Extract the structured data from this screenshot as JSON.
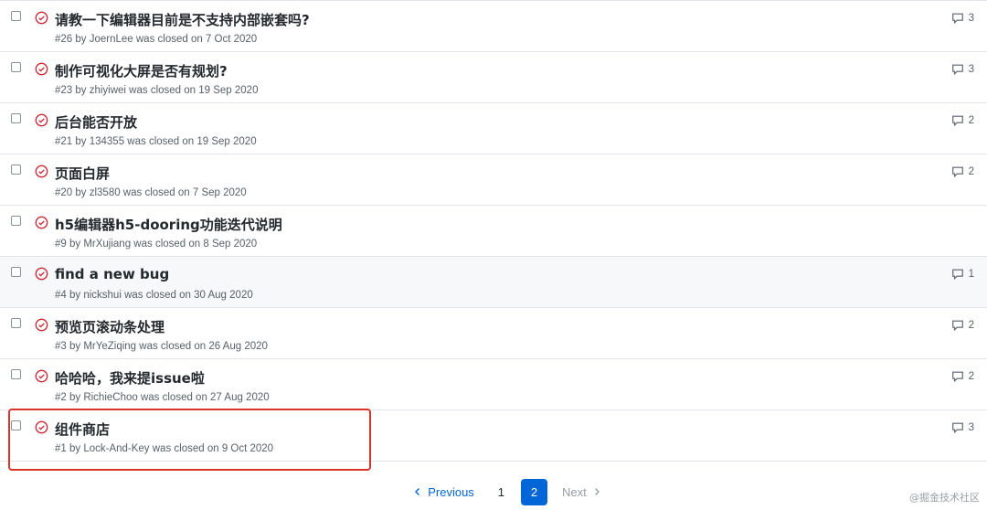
{
  "issues": [
    {
      "title": "请教一下编辑器目前是不支持内部嵌套吗?",
      "meta": "#26 by JoernLee was closed on 7 Oct 2020",
      "comments": "3"
    },
    {
      "title": "制作可视化大屏是否有规划?",
      "meta": "#23 by zhiyiwei was closed on 19 Sep 2020",
      "comments": "3"
    },
    {
      "title": "后台能否开放",
      "meta": "#21 by 134355 was closed on 19 Sep 2020",
      "comments": "2"
    },
    {
      "title": "页面白屏",
      "meta": "#20 by zl3580 was closed on 7 Sep 2020",
      "comments": "2"
    },
    {
      "title": "h5编辑器h5-dooring功能迭代说明",
      "meta": "#9 by MrXujiang was closed on 8 Sep 2020",
      "comments": ""
    },
    {
      "title": "find a new bug",
      "meta": "#4 by nickshui was closed on 30 Aug 2020",
      "comments": "1"
    },
    {
      "title": "预览页滚动条处理",
      "meta": "#3 by MrYeZiqing was closed on 26 Aug 2020",
      "comments": "2"
    },
    {
      "title": "哈哈哈，我来提issue啦",
      "meta": "#2 by RichieChoo was closed on 27 Aug 2020",
      "comments": "2"
    },
    {
      "title": "组件商店",
      "meta": "#1 by Lock-And-Key was closed on 9 Oct 2020",
      "comments": "3"
    }
  ],
  "pagination": {
    "previous": "Previous",
    "page1": "1",
    "page2": "2",
    "next": "Next"
  },
  "watermark": "@掘金技术社区",
  "colors": {
    "closed_icon": "#cb2431",
    "accent": "#0366d6",
    "highlight_box": "#d9342b"
  }
}
